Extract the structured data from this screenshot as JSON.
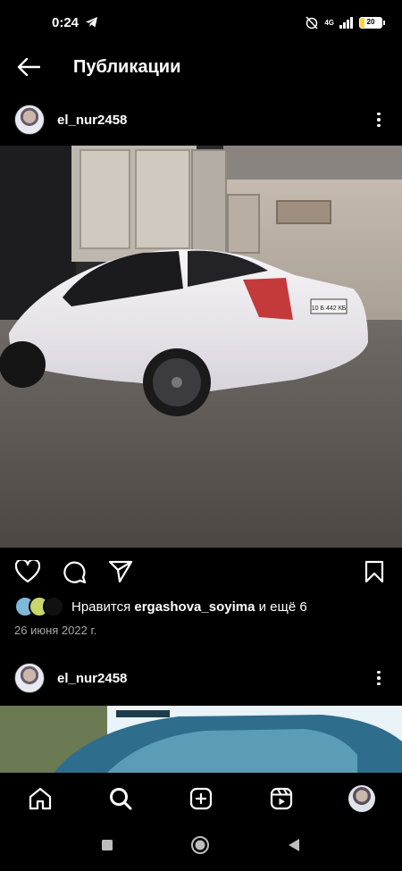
{
  "status_bar": {
    "time": "0:24",
    "network": "4G",
    "battery": "20"
  },
  "header": {
    "title": "Публикации",
    "back_icon": "arrow-left-icon"
  },
  "posts": [
    {
      "username": "el_nur2458",
      "likes_prefix": "Нравится ",
      "likes_user": "ergashova_soyima",
      "likes_suffix": " и ещё 6",
      "date": "26 июня 2022 г.",
      "plate": "10 Б 442 КБ"
    },
    {
      "username": "el_nur2458"
    }
  ],
  "bottom_nav": [
    "home-icon",
    "search-icon",
    "create-icon",
    "reels-icon",
    "profile-avatar"
  ],
  "system_nav": [
    "recents-icon",
    "home-circle-icon",
    "back-triangle-icon"
  ]
}
